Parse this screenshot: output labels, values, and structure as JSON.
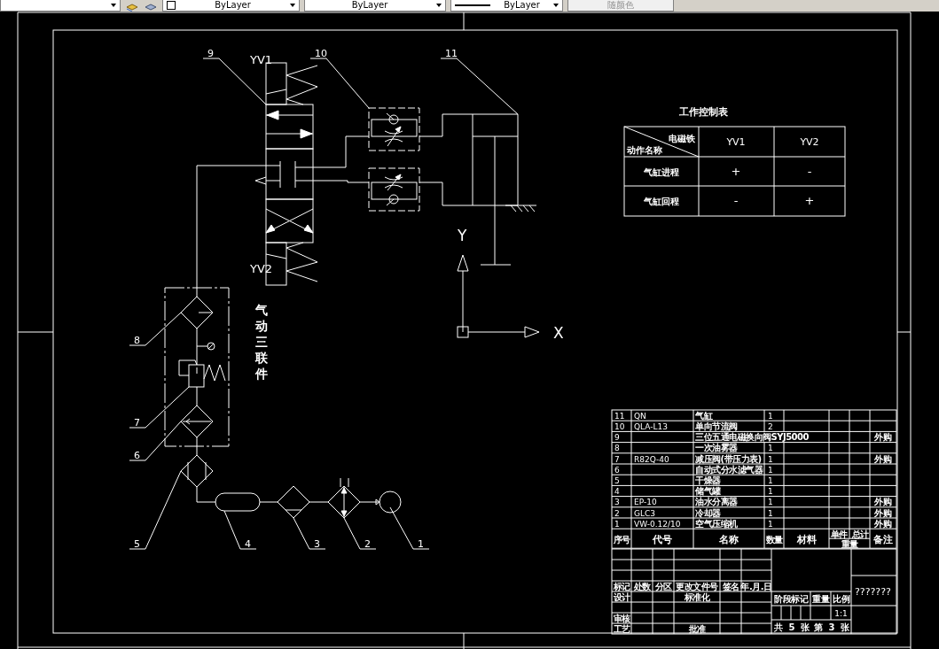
{
  "toolbar": {
    "dropdowns": [
      {
        "value": "ByLayer",
        "disabled": false
      },
      {
        "value": "ByLayer",
        "disabled": false
      },
      {
        "value": "ByLayer",
        "disabled": false
      },
      {
        "value": "随颜色",
        "disabled": true
      }
    ]
  },
  "schematic": {
    "balloons": [
      "9",
      "10",
      "11",
      "8",
      "7",
      "6",
      "5",
      "4",
      "3",
      "2",
      "1"
    ],
    "solenoids": [
      "YV1",
      "YV2"
    ],
    "unit_label": "气动三联件",
    "axes": [
      "Y",
      "X"
    ]
  },
  "control_table": {
    "title": "工作控制表",
    "corner_top": "电磁铁",
    "corner_bottom": "动作名称",
    "columns": [
      "YV1",
      "YV2"
    ],
    "rows": [
      {
        "name": "气缸进程",
        "cells": [
          "+",
          "-"
        ]
      },
      {
        "name": "气缸回程",
        "cells": [
          "-",
          "+"
        ]
      }
    ]
  },
  "parts_list": {
    "rows": [
      {
        "no": "11",
        "code": "QN",
        "name": "气缸",
        "qty": "1"
      },
      {
        "no": "10",
        "code": "QLA-L13",
        "name": "单向节流阀",
        "qty": "2"
      },
      {
        "no": "9",
        "name": "三位五通电磁换向阀SYJ5000",
        "remark": "外购"
      },
      {
        "no": "8",
        "name": "一次油雾器",
        "qty": "1"
      },
      {
        "no": "7",
        "code": "R82Q-40",
        "name": "减压阀(带压力表)",
        "qty": "1",
        "remark": "外购"
      },
      {
        "no": "6",
        "name": "自动式分水滤气器",
        "qty": "1"
      },
      {
        "no": "5",
        "name": "干燥器",
        "qty": "1"
      },
      {
        "no": "4",
        "name": "储气罐",
        "qty": "1"
      },
      {
        "no": "3",
        "code": "EP-10",
        "name": "油水分离器",
        "qty": "1",
        "remark": "外购"
      },
      {
        "no": "2",
        "code": "GLC3",
        "name": "冷却器",
        "qty": "1",
        "remark": "外购"
      },
      {
        "no": "1",
        "code": "VW-0.12/10",
        "name": "空气压缩机",
        "qty": "1",
        "remark": "外购"
      }
    ],
    "header": {
      "no": "序号",
      "code": "代号",
      "name": "名称",
      "qty": "数量",
      "material": "材料",
      "unit": "单件",
      "total": "总计",
      "weight": "重量",
      "remark": "备注"
    }
  },
  "title_block": {
    "revision_headers": [
      "标记",
      "处数",
      "分区",
      "更改文件号",
      "签名",
      "年.月.日"
    ],
    "roles": [
      "设计",
      "审核",
      "工艺"
    ],
    "role_labels": [
      "标准化",
      "批准"
    ],
    "stage_headers": [
      "阶段标记",
      "重量",
      "比例"
    ],
    "scale": "1:1",
    "sheets": [
      "共",
      "5",
      "张",
      "第",
      "3",
      "张"
    ],
    "drawing_name": "???????"
  }
}
